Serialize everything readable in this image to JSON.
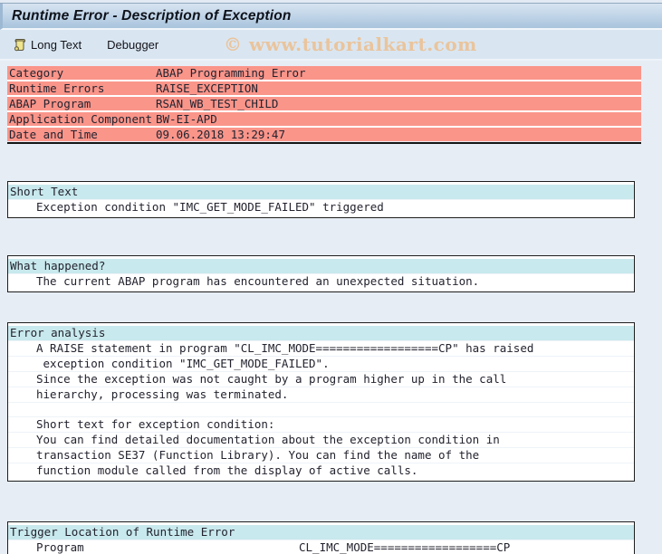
{
  "window": {
    "title": "Runtime Error - Description of Exception"
  },
  "toolbar": {
    "buttons": [
      {
        "label": "Long Text",
        "icon": "scroll-icon"
      },
      {
        "label": "Debugger"
      }
    ],
    "watermark": "© www.tutorialkart.com"
  },
  "error_table": {
    "rows": [
      {
        "label": "Category",
        "value": "ABAP Programming Error"
      },
      {
        "label": "Runtime Errors",
        "value": "RAISE_EXCEPTION"
      },
      {
        "label": "ABAP Program",
        "value": "RSAN_WB_TEST_CHILD"
      },
      {
        "label": "Application Component",
        "value": "BW-EI-APD"
      },
      {
        "label": "Date and Time",
        "value": "09.06.2018 13:29:47"
      }
    ]
  },
  "sections": [
    {
      "title": "Short Text",
      "lines": [
        "Exception condition \"IMC_GET_MODE_FAILED\" triggered"
      ]
    },
    {
      "title": "What happened?",
      "lines": [
        "The current ABAP program has encountered an unexpected situation."
      ]
    },
    {
      "title": "Error analysis",
      "lines": [
        "A RAISE statement in program \"CL_IMC_MODE==================CP\" has raised",
        " exception condition \"IMC_GET_MODE_FAILED\".",
        "Since the exception was not caught by a program higher up in the call",
        "hierarchy, processing was terminated.",
        "",
        "Short text for exception condition:",
        "You can find detailed documentation about the exception condition in",
        "transaction SE37 (Function Library). You can find the name of the",
        "function module called from the display of active calls."
      ]
    },
    {
      "title": "Trigger Location of Runtime Error",
      "rows": [
        {
          "label": "Program",
          "value": "CL_IMC_MODE==================CP"
        }
      ]
    }
  ],
  "colors": {
    "error_row": "#fa958a",
    "section_header_bg": "#c8e9ed",
    "watermark": "#ecc193",
    "titlebar_gradient_top": "#d7e4f1",
    "titlebar_gradient_bottom": "#a8c4dc",
    "page_background": "#e7edf5",
    "toolbar_background": "#d9e6f2"
  }
}
